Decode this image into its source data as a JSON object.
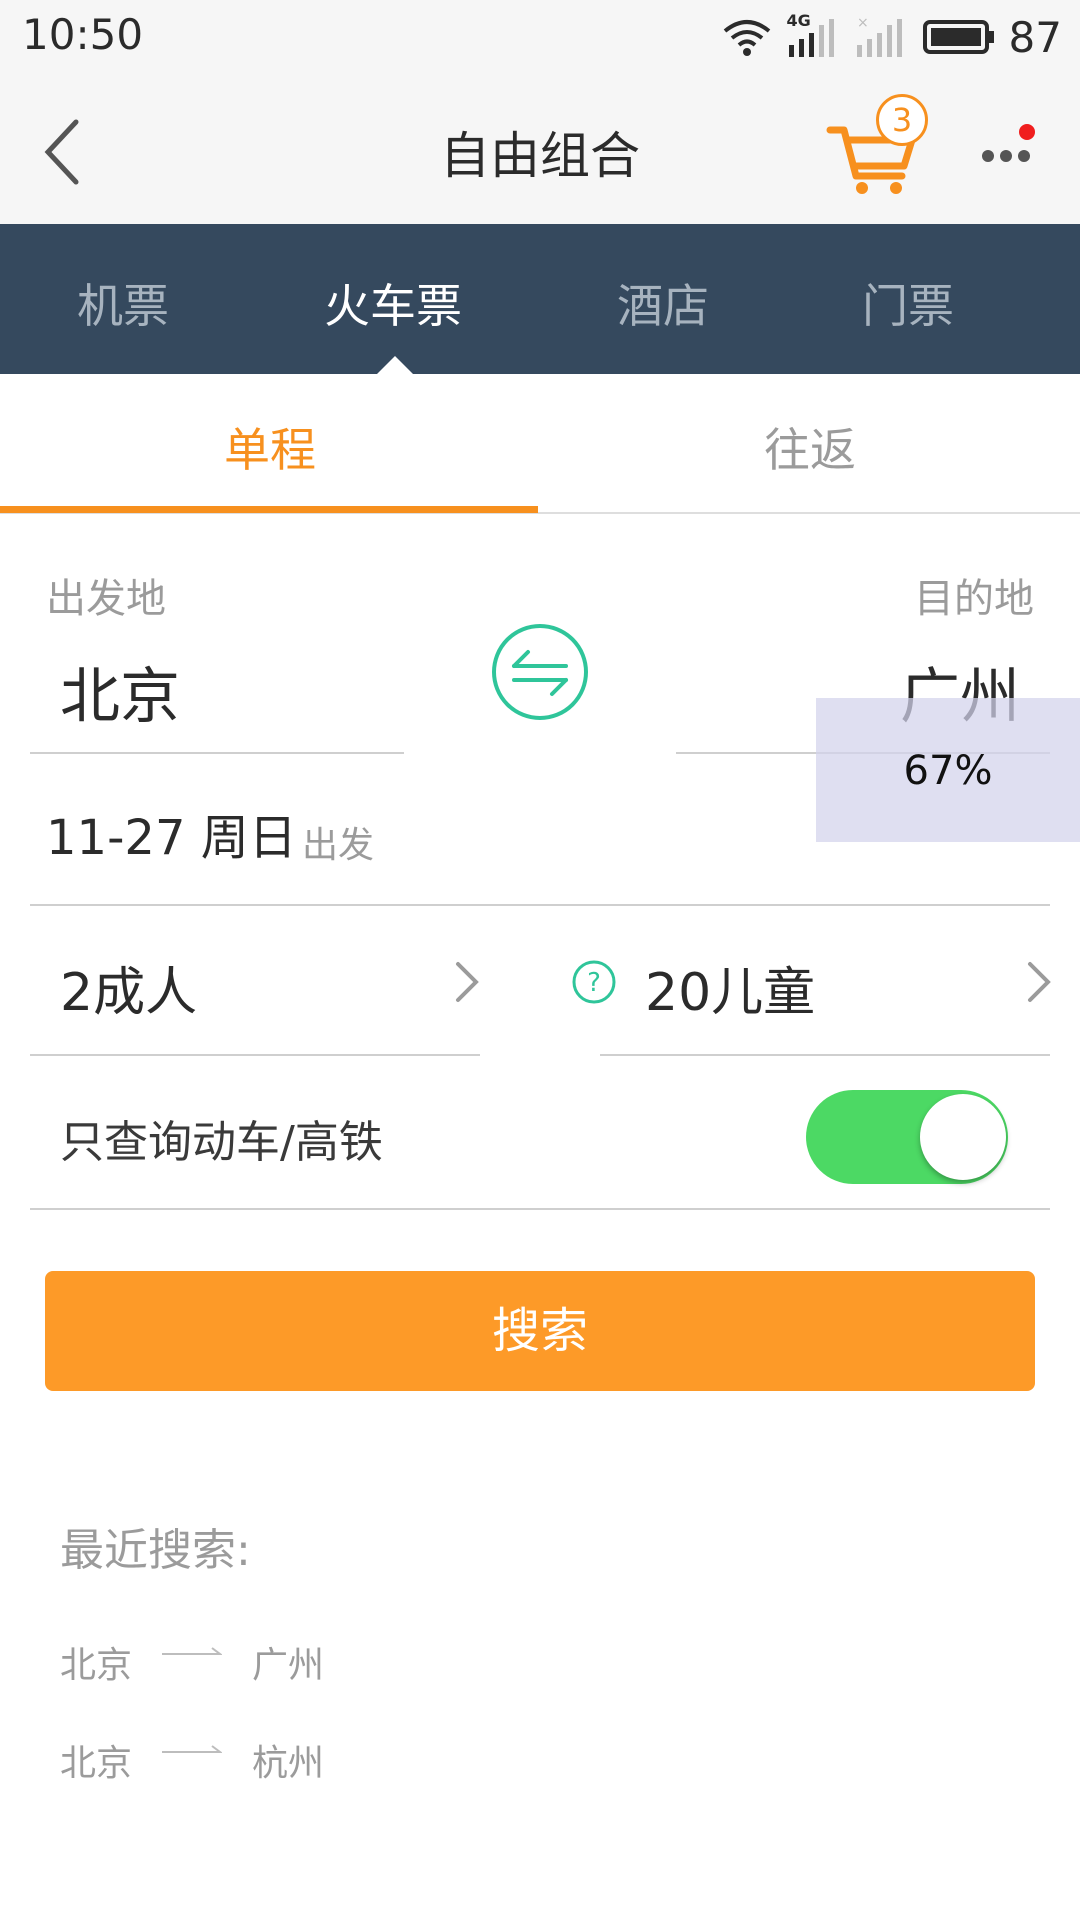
{
  "status_bar": {
    "time": "10:50",
    "network": "4G",
    "battery_level": "87"
  },
  "header": {
    "title": "自由组合",
    "cart_count": "3",
    "more_has_notification": true
  },
  "category_tabs": [
    {
      "label": "机票",
      "active": false
    },
    {
      "label": "火车票",
      "active": true
    },
    {
      "label": "酒店",
      "active": false
    },
    {
      "label": "门票",
      "active": false
    }
  ],
  "trip_tabs": [
    {
      "label": "单程",
      "active": true
    },
    {
      "label": "往返",
      "active": false
    }
  ],
  "route": {
    "from_label": "出发地",
    "to_label": "目的地",
    "from_city": "北京",
    "to_city": "广州"
  },
  "overlay": {
    "text": "67%"
  },
  "date": {
    "value": "11-27 周日",
    "suffix": "出发"
  },
  "passengers": {
    "adults": "2成人",
    "children": "20儿童"
  },
  "filter": {
    "label": "只查询动车/高铁",
    "enabled": true
  },
  "search_button": {
    "label": "搜索"
  },
  "recent": {
    "title": "最近搜索:",
    "items": [
      {
        "from": "北京",
        "to": "广州"
      },
      {
        "from": "北京",
        "to": "杭州"
      }
    ]
  },
  "colors": {
    "accent": "#f7901e",
    "search_button": "#fd9a28",
    "tab_bar": "#35495e",
    "toggle_on": "#4cd964",
    "swap_icon": "#2fc59a"
  },
  "icons": {
    "back": "back-chevron-icon",
    "cart": "shopping-cart-icon",
    "more": "more-dots-icon",
    "swap": "swap-arrows-icon",
    "help": "question-circle-icon",
    "chevron": "chevron-right-icon",
    "recent_arrow": "long-arrow-right-icon"
  }
}
